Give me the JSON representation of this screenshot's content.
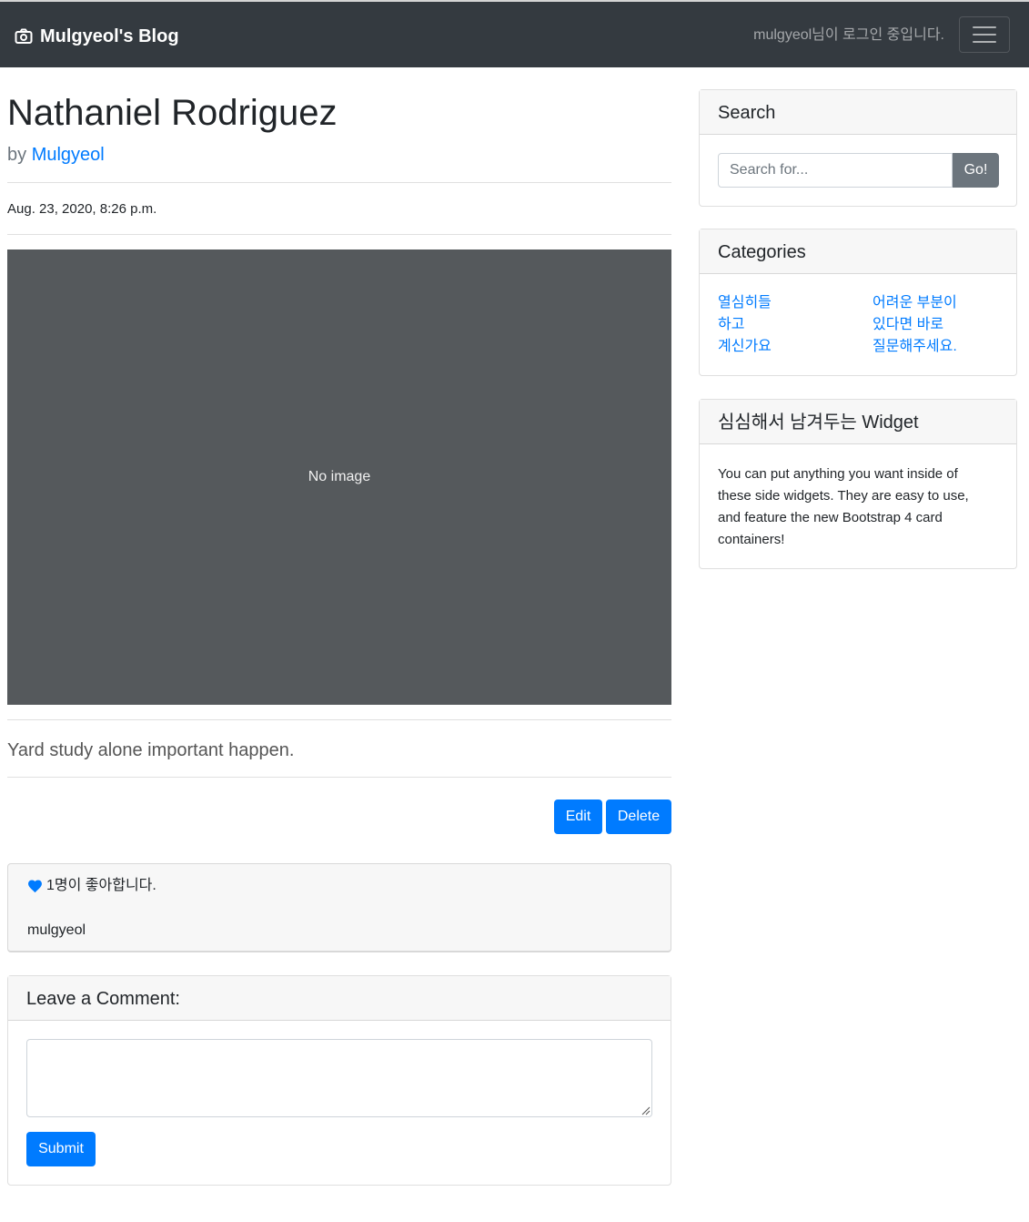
{
  "navbar": {
    "brand": "Mulgyeol's Blog",
    "brand_icon": "camera-icon",
    "login_status": "mulgyeol님이 로그인 중입니다.",
    "toggler_icon": "hamburger-menu-icon"
  },
  "post": {
    "title": "Nathaniel Rodriguez",
    "by_prefix": "by ",
    "author": "Mulgyeol",
    "date": "Aug. 23, 2020, 8:26 p.m.",
    "image_placeholder": "No image",
    "content": "Yard study alone important happen.",
    "edit_label": "Edit",
    "delete_label": "Delete"
  },
  "likes": {
    "icon": "heart-icon",
    "count_text": "1명이 좋아합니다.",
    "users": [
      "mulgyeol"
    ]
  },
  "comment_form": {
    "heading": "Leave a Comment:",
    "textarea_value": "",
    "submit_label": "Submit"
  },
  "sidebar": {
    "search": {
      "heading": "Search",
      "placeholder": "Search for...",
      "button_label": "Go!"
    },
    "categories": {
      "heading": "Categories",
      "items": [
        "열심히들",
        "하고",
        "계신가요",
        "어려운 부분이",
        "있다면 바로",
        "질문해주세요."
      ]
    },
    "widget": {
      "heading": "심심해서 남겨두는 Widget",
      "text": "You can put anything you want inside of these side widgets. They are easy to use, and feature the new Bootstrap 4 card containers!"
    }
  },
  "colors": {
    "navbar_bg": "#343a40",
    "primary": "#007bff",
    "secondary": "#6c757d",
    "image_bg": "#55595c"
  }
}
